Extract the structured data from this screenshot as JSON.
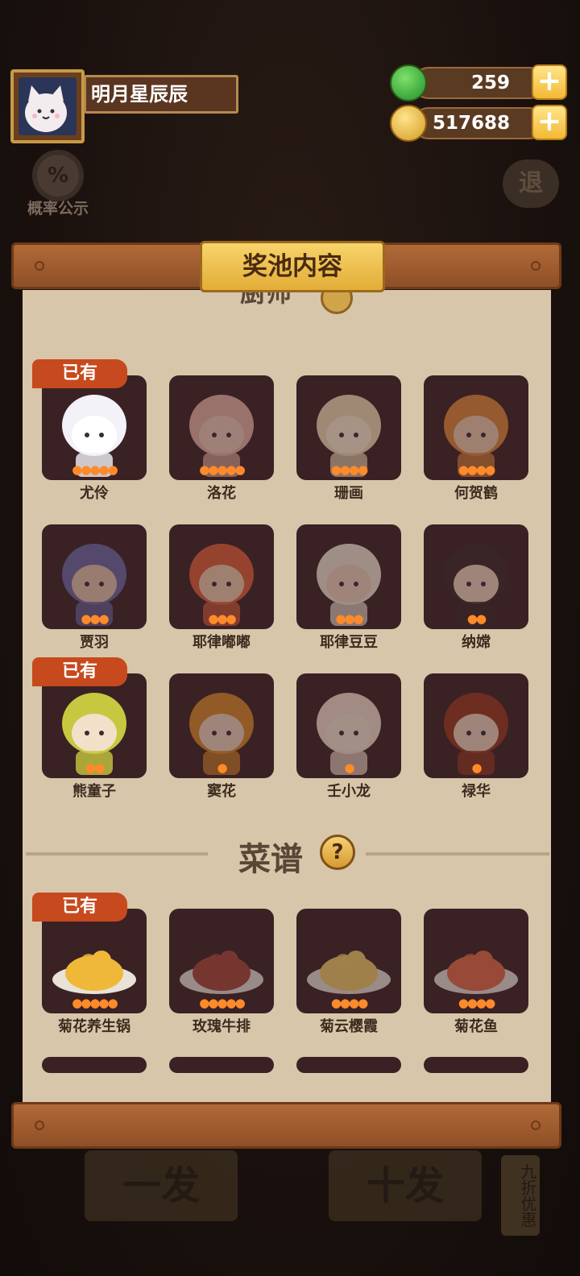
{
  "player": {
    "name": "明月星辰辰"
  },
  "currency": {
    "jade": "259",
    "coins": "517688"
  },
  "background": {
    "probability_label": "概率公示",
    "exit_label": "退",
    "single_draw": "一发",
    "ten_draw": "十发",
    "discount": "九折优惠"
  },
  "panel": {
    "title": "奖池内容",
    "owned_label": "已有",
    "chefs_section": "厨师",
    "recipes_section": "菜谱",
    "help_glyph": "?",
    "chefs": [
      {
        "name": "尤伶",
        "stars": 5,
        "owned": true
      },
      {
        "name": "洛花",
        "stars": 5,
        "owned": false
      },
      {
        "name": "珊画",
        "stars": 4,
        "owned": false
      },
      {
        "name": "何贺鹤",
        "stars": 4,
        "owned": false
      },
      {
        "name": "贾羽",
        "stars": 3,
        "owned": false
      },
      {
        "name": "耶律嘟嘟",
        "stars": 3,
        "owned": false
      },
      {
        "name": "耶律豆豆",
        "stars": 3,
        "owned": false
      },
      {
        "name": "纳嫦",
        "stars": 2,
        "owned": false
      },
      {
        "name": "熊童子",
        "stars": 2,
        "owned": true
      },
      {
        "name": "窦花",
        "stars": 1,
        "owned": false
      },
      {
        "name": "壬小龙",
        "stars": 1,
        "owned": false
      },
      {
        "name": "禄华",
        "stars": 1,
        "owned": false
      }
    ],
    "recipes": [
      {
        "name": "菊花养生锅",
        "stars": 5,
        "owned": true
      },
      {
        "name": "玫瑰牛排",
        "stars": 5,
        "owned": false
      },
      {
        "name": "菊云樱霞",
        "stars": 4,
        "owned": false
      },
      {
        "name": "菊花鱼",
        "stars": 4,
        "owned": false
      }
    ]
  },
  "colors": {
    "card_bg": "#3a2124",
    "badge": "#c7491e",
    "paper": "#d8c6aa",
    "flame": "#ff8a2a"
  }
}
